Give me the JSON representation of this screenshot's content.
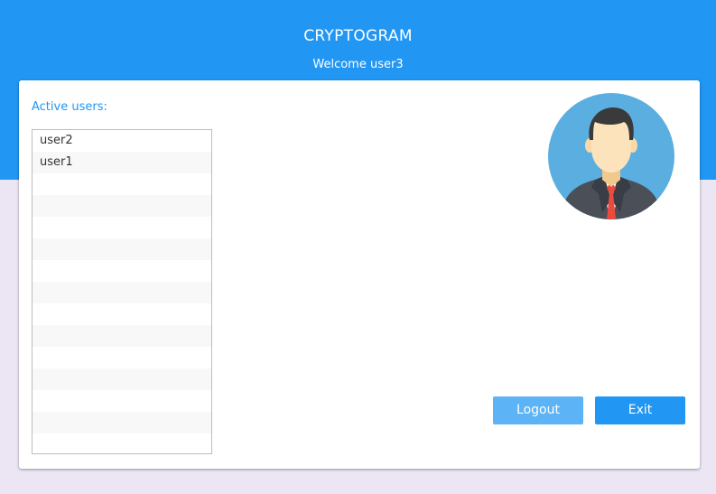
{
  "header": {
    "title": "CRYPTOGRAM",
    "welcome": "Welcome user3"
  },
  "users_panel": {
    "label": "Active users:",
    "users": [
      "user2",
      "user1"
    ]
  },
  "avatar": {
    "icon": "user-avatar-icon"
  },
  "actions": {
    "logout_label": "Logout",
    "exit_label": "Exit"
  },
  "colors": {
    "primary": "#2196F3",
    "secondary_button": "#5CB3F5",
    "background": "#ECE6F4",
    "avatar_circle": "#5AAEE0",
    "tie": "#E94B3C"
  }
}
